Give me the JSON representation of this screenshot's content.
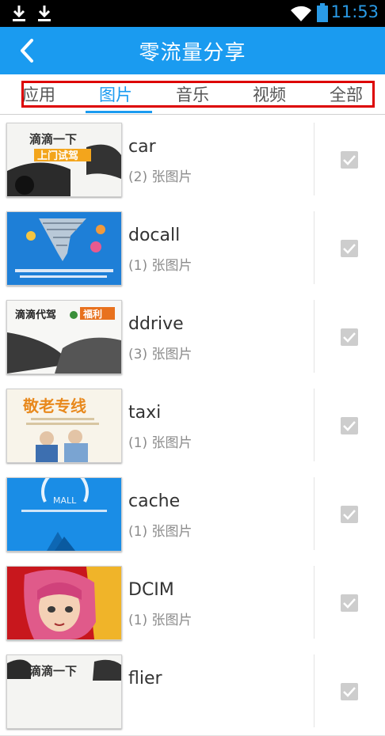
{
  "status_bar": {
    "time": "11:53"
  },
  "header": {
    "title": "零流量分享"
  },
  "tabs": [
    {
      "label": "应用"
    },
    {
      "label": "图片"
    },
    {
      "label": "音乐"
    },
    {
      "label": "视频"
    },
    {
      "label": "全部"
    }
  ],
  "active_tab": "图片",
  "rows": [
    {
      "name": "car",
      "count": "(2) 张图片",
      "checked": true
    },
    {
      "name": "docall",
      "count": "(1) 张图片",
      "checked": true
    },
    {
      "name": "ddrive",
      "count": "(3) 张图片",
      "checked": true
    },
    {
      "name": "taxi",
      "count": "(1) 张图片",
      "checked": true
    },
    {
      "name": "cache",
      "count": "(1) 张图片",
      "checked": true
    },
    {
      "name": "DCIM",
      "count": "(1) 张图片",
      "checked": true
    },
    {
      "name": "flier",
      "count": "",
      "checked": true
    }
  ],
  "thumbnails": {
    "car": {
      "line1": "滴滴一下",
      "line2": "上门试驾"
    },
    "ddrive": {
      "line1": "滴滴代驾",
      "line2": "福利"
    },
    "taxi": {
      "line1": "敬老专线"
    },
    "cache": {
      "line1": "MALL"
    },
    "flier": {
      "line1": "滴滴一下"
    }
  },
  "colors": {
    "accent": "#1a9bf0",
    "highlight_box": "#dd0000"
  }
}
